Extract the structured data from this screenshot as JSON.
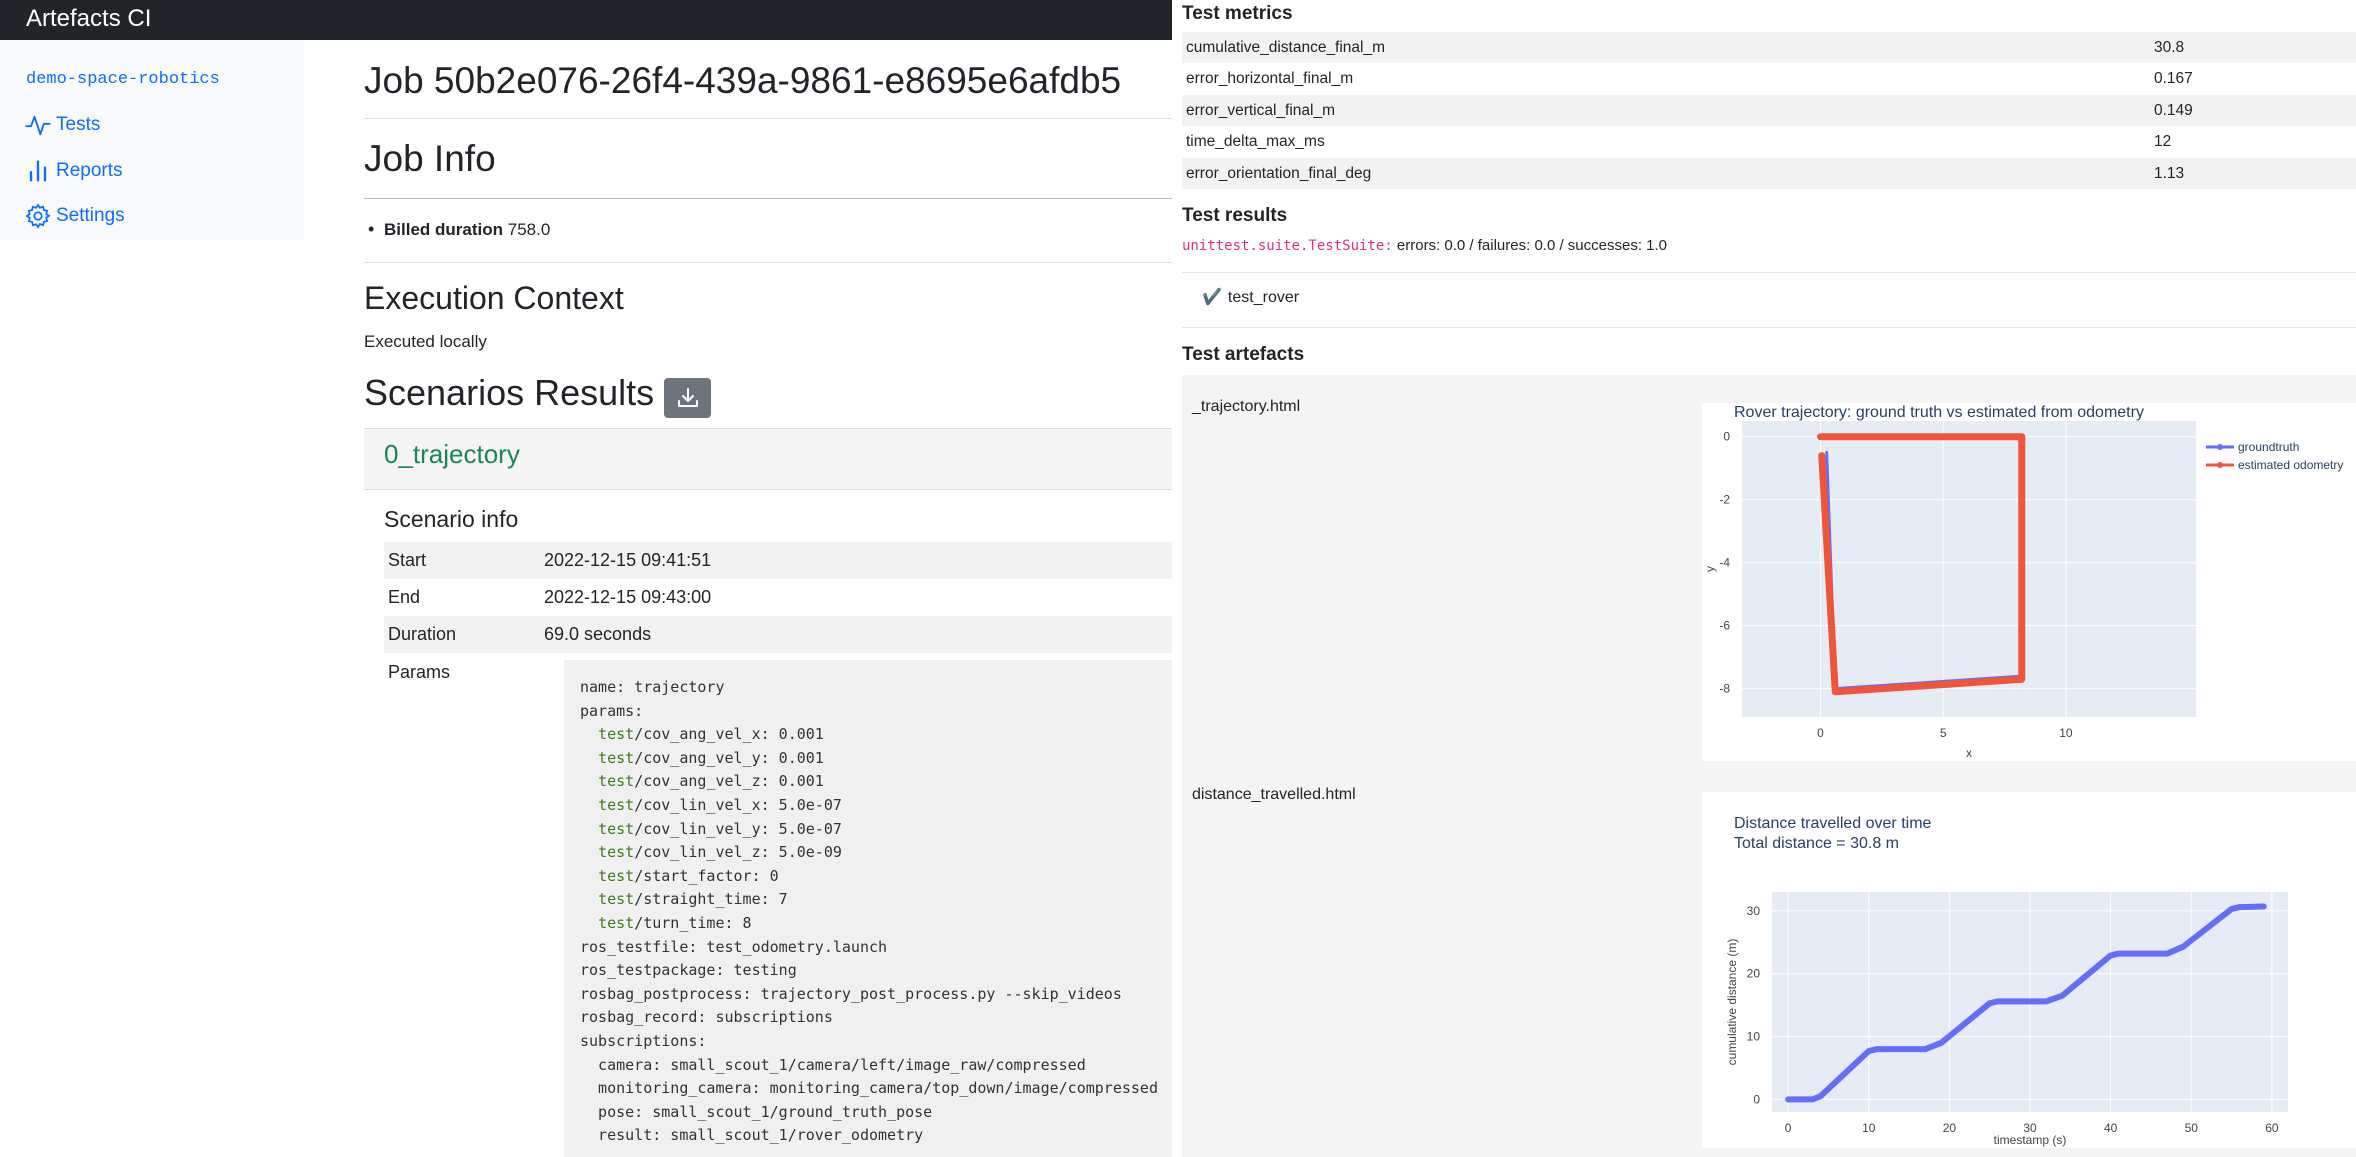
{
  "app": {
    "title": "Artefacts CI"
  },
  "sidebar": {
    "project": "demo-space-robotics",
    "items": [
      {
        "label": "Tests",
        "icon": "activity-icon"
      },
      {
        "label": "Reports",
        "icon": "bar-chart-icon"
      },
      {
        "label": "Settings",
        "icon": "gear-icon"
      }
    ]
  },
  "job": {
    "title": "Job 50b2e076-26f4-439a-9861-e8695e6afdb5",
    "info_heading": "Job Info",
    "billed_label": "Billed duration",
    "billed_value": "758.0",
    "exec_heading": "Execution Context",
    "exec_value": "Executed locally",
    "scenarios_heading": "Scenarios Results"
  },
  "scenario": {
    "name": "0_trajectory",
    "info_heading": "Scenario info",
    "rows": [
      {
        "key": "Start",
        "value": "2022-12-15 09:41:51"
      },
      {
        "key": "End",
        "value": "2022-12-15 09:43:00"
      },
      {
        "key": "Duration",
        "value": "69.0 seconds"
      }
    ],
    "params_key": "Params",
    "params_lines": [
      "name: trajectory",
      "params:",
      "  test/cov_ang_vel_x: 0.001",
      "  test/cov_ang_vel_y: 0.001",
      "  test/cov_ang_vel_z: 0.001",
      "  test/cov_lin_vel_x: 5.0e-07",
      "  test/cov_lin_vel_y: 5.0e-07",
      "  test/cov_lin_vel_z: 5.0e-09",
      "  test/start_factor: 0",
      "  test/straight_time: 7",
      "  test/turn_time: 8",
      "ros_testfile: test_odometry.launch",
      "ros_testpackage: testing",
      "rosbag_postprocess: trajectory_post_process.py --skip_videos",
      "rosbag_record: subscriptions",
      "subscriptions:",
      "  camera: small_scout_1/camera/left/image_raw/compressed",
      "  monitoring_camera: monitoring_camera/top_down/image/compressed",
      "  pose: small_scout_1/ground_truth_pose",
      "  result: small_scout_1/rover_odometry"
    ]
  },
  "metrics": {
    "heading": "Test metrics",
    "rows": [
      {
        "key": "cumulative_distance_final_m",
        "value": "30.8"
      },
      {
        "key": "error_horizontal_final_m",
        "value": "0.167"
      },
      {
        "key": "error_vertical_final_m",
        "value": "0.149"
      },
      {
        "key": "time_delta_max_ms",
        "value": "12"
      },
      {
        "key": "error_orientation_final_deg",
        "value": "1.13"
      }
    ]
  },
  "results": {
    "heading": "Test results",
    "suite": "unittest.suite.TestSuite:",
    "summary": "errors: 0.0 / failures: 0.0 / successes: 1.0",
    "test_name": "test_rover",
    "check": "✔️"
  },
  "artefacts": {
    "heading": "Test artefacts",
    "items": [
      {
        "label": "_trajectory.html"
      },
      {
        "label": "distance_travelled.html"
      }
    ]
  },
  "colors": {
    "groundtruth": "#636efa",
    "odometry": "#ef553b",
    "plot_bg": "#e5ecf6",
    "link": "#0d6efd",
    "scenario": "#198754"
  },
  "chart_data": [
    {
      "type": "line",
      "title": "Rover trajectory: ground truth vs estimated from odometry",
      "xlabel": "x",
      "ylabel": "y",
      "xlim": [
        -3.2,
        15.3
      ],
      "ylim": [
        -8.9,
        0.5
      ],
      "xticks": [
        "0",
        "5",
        "10"
      ],
      "yticks": [
        "0",
        "-2",
        "-4",
        "-6",
        "-8"
      ],
      "legend": "top-right",
      "series": [
        {
          "name": "groundtruth",
          "x": [
            0.25,
            0.6,
            8.2,
            8.2,
            0.0
          ],
          "y": [
            -0.5,
            -8.0,
            -7.6,
            0.0,
            0.0
          ]
        },
        {
          "name": "estimated odometry",
          "x": [
            0.05,
            0.6,
            8.2,
            8.2,
            0.0
          ],
          "y": [
            -0.6,
            -8.1,
            -7.7,
            0.0,
            0.0
          ]
        }
      ]
    },
    {
      "type": "line",
      "title": "Distance travelled over time",
      "subtitle": "Total distance = 30.8 m",
      "xlabel": "timestamp (s)",
      "ylabel": "cumulative distance (m)",
      "xlim": [
        -2,
        62
      ],
      "ylim": [
        -2,
        33
      ],
      "xticks": [
        "0",
        "10",
        "20",
        "30",
        "40",
        "50",
        "60"
      ],
      "yticks": [
        "0",
        "10",
        "20",
        "30"
      ],
      "series": [
        {
          "name": "",
          "x": [
            0,
            3,
            4,
            10,
            11,
            17,
            19,
            25,
            26,
            32,
            34,
            40,
            41,
            47,
            49,
            55,
            56,
            59
          ],
          "y": [
            0,
            0,
            0.5,
            7.7,
            8,
            8,
            9,
            15.3,
            15.6,
            15.6,
            16.5,
            22.9,
            23.2,
            23.2,
            24.3,
            30.3,
            30.6,
            30.7
          ]
        }
      ]
    }
  ]
}
